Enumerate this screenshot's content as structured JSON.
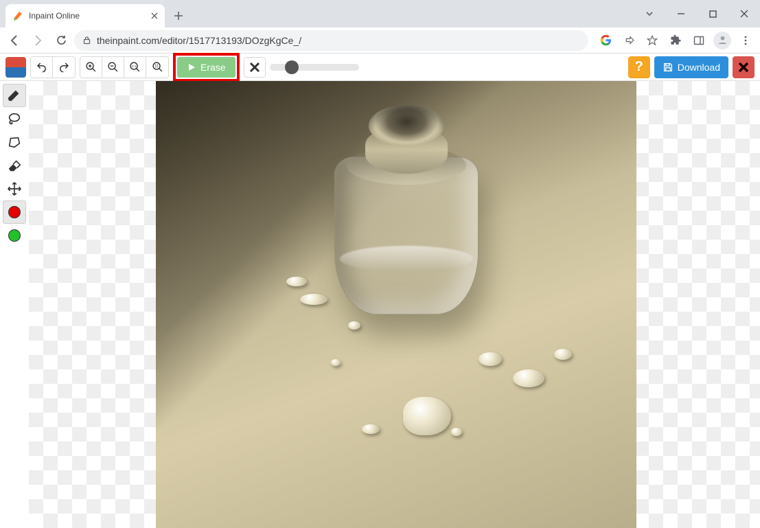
{
  "browser": {
    "tab_title": "Inpaint Online",
    "url": "theinpaint.com/editor/1517713193/DOzgKgCe_/"
  },
  "toolbar": {
    "erase_label": "Erase",
    "download_label": "Download",
    "help_label": "?"
  },
  "sidebar": {
    "red_color": "#e60000",
    "green_color": "#22c02a"
  },
  "annotation": {
    "highlight": "erase-button-red-box"
  }
}
